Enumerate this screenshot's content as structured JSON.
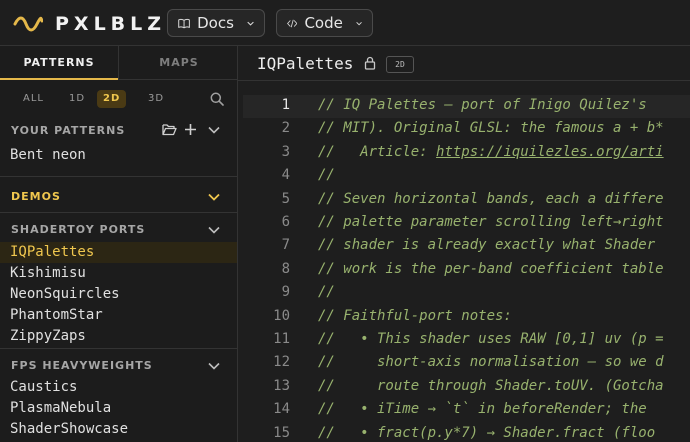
{
  "app": {
    "logo_text": "PXLBLZ",
    "docs_label": "Docs",
    "code_label": "Code"
  },
  "colors": {
    "accent": "#e5b84a",
    "comment": "#98b26e",
    "background": "#1e1e1e"
  },
  "sidebar": {
    "tabs": [
      "PATTERNS",
      "MAPS"
    ],
    "active_tab": "PATTERNS",
    "filters": [
      "ALL",
      "1D",
      "2D",
      "3D"
    ],
    "active_filter": "2D",
    "your_patterns_header": "YOUR PATTERNS",
    "your_patterns": [
      "Bent neon"
    ],
    "demos_header": "DEMOS",
    "shadertoy_header": "SHADERTOY PORTS",
    "shadertoy_items": [
      "IQPalettes",
      "Kishimisu",
      "NeonSquircles",
      "PhantomStar",
      "ZippyZaps"
    ],
    "selected_item": "IQPalettes",
    "fps_header": "FPS HEAVYWEIGHTS",
    "fps_items": [
      "Caustics",
      "PlasmaNebula",
      "ShaderShowcase"
    ]
  },
  "editor": {
    "title": "IQPalettes",
    "badge": "2D",
    "current_line": 1,
    "lines": [
      {
        "n": "1",
        "text": "// IQ Palettes — port of Inigo Quilez's"
      },
      {
        "n": "2",
        "text": "// MIT). Original GLSL: the famous a + b*"
      },
      {
        "n": "3",
        "pre": "//   Article: ",
        "link": "https://iquilezles.org/arti"
      },
      {
        "n": "4",
        "text": "//"
      },
      {
        "n": "5",
        "text": "// Seven horizontal bands, each a differe"
      },
      {
        "n": "6",
        "text": "// palette parameter scrolling left→right"
      },
      {
        "n": "7",
        "text": "// shader is already exactly what Shader"
      },
      {
        "n": "8",
        "text": "// work is the per-band coefficient table"
      },
      {
        "n": "9",
        "text": "//"
      },
      {
        "n": "10",
        "text": "// Faithful-port notes:"
      },
      {
        "n": "11",
        "text": "//   • This shader uses RAW [0,1] uv (p ="
      },
      {
        "n": "12",
        "text": "//     short-axis normalisation — so we d"
      },
      {
        "n": "13",
        "text": "//     route through Shader.toUV. (Gotcha"
      },
      {
        "n": "14",
        "text": "//   • iTime → `t` in beforeRender; the"
      },
      {
        "n": "15",
        "text": "//   • fract(p.y*7) → Shader.fract (floo"
      }
    ]
  }
}
